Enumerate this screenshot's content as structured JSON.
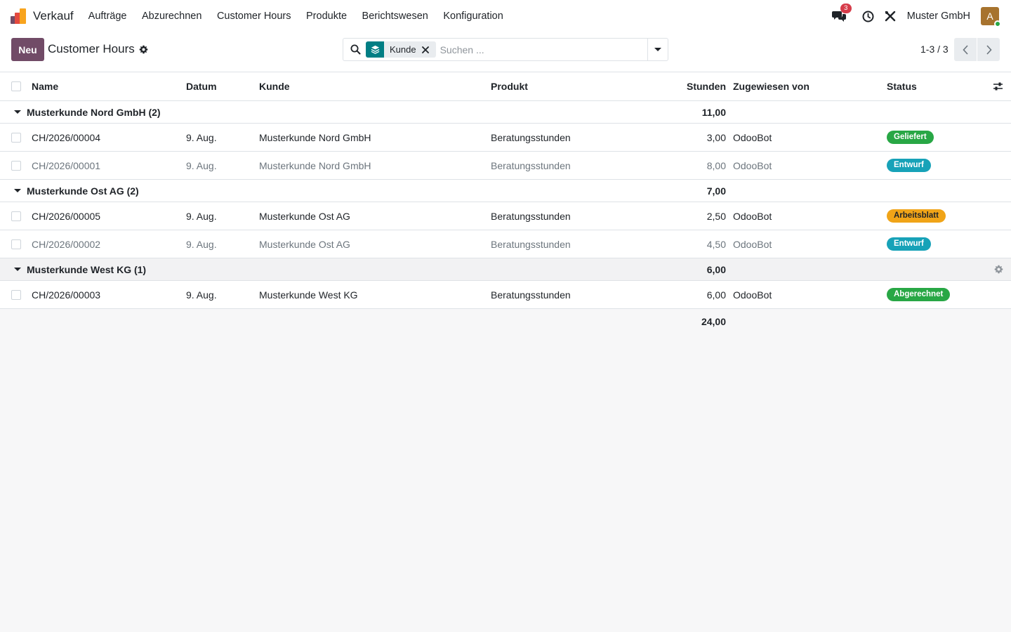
{
  "navbar": {
    "app_name": "Verkauf",
    "menu": [
      "Aufträge",
      "Abzurechnen",
      "Customer Hours",
      "Produkte",
      "Berichtswesen",
      "Konfiguration"
    ],
    "chat_badge": "3",
    "company": "Muster GmbH",
    "avatar_initial": "A"
  },
  "control": {
    "new_label": "Neu",
    "title": "Customer Hours",
    "search": {
      "facet": "Kunde",
      "placeholder": "Suchen ..."
    },
    "pager": "1-3 / 3"
  },
  "table": {
    "columns": {
      "name": "Name",
      "date": "Datum",
      "customer": "Kunde",
      "product": "Produkt",
      "hours": "Stunden",
      "assigned": "Zugewiesen von",
      "status": "Status"
    },
    "groups": [
      {
        "title": "Musterkunde Nord GmbH (2)",
        "hours": "11,00",
        "rows": [
          {
            "name": "CH/2026/00004",
            "date": "9. Aug.",
            "customer": "Musterkunde Nord GmbH",
            "product": "Beratungsstunden",
            "hours": "3,00",
            "assigned": "OdooBot",
            "status": "Geliefert",
            "status_color": "#28a745",
            "muted": false
          },
          {
            "name": "CH/2026/00001",
            "date": "9. Aug.",
            "customer": "Musterkunde Nord GmbH",
            "product": "Beratungsstunden",
            "hours": "8,00",
            "assigned": "OdooBot",
            "status": "Entwurf",
            "status_color": "#17a2b8",
            "muted": true
          }
        ]
      },
      {
        "title": "Musterkunde Ost AG (2)",
        "hours": "7,00",
        "rows": [
          {
            "name": "CH/2026/00005",
            "date": "9. Aug.",
            "customer": "Musterkunde Ost AG",
            "product": "Beratungsstunden",
            "hours": "2,50",
            "assigned": "OdooBot",
            "status": "Arbeitsblatt",
            "status_color": "#f0a418",
            "muted": false
          },
          {
            "name": "CH/2026/00002",
            "date": "9. Aug.",
            "customer": "Musterkunde Ost AG",
            "product": "Beratungsstunden",
            "hours": "4,50",
            "assigned": "OdooBot",
            "status": "Entwurf",
            "status_color": "#17a2b8",
            "muted": true
          }
        ]
      },
      {
        "title": "Musterkunde West KG (1)",
        "hours": "6,00",
        "rows": [
          {
            "name": "CH/2026/00003",
            "date": "9. Aug.",
            "customer": "Musterkunde West KG",
            "product": "Beratungsstunden",
            "hours": "6,00",
            "assigned": "OdooBot",
            "status": "Abgerechnet",
            "status_color": "#28a745",
            "muted": false
          }
        ]
      }
    ],
    "total_hours": "24,00"
  }
}
